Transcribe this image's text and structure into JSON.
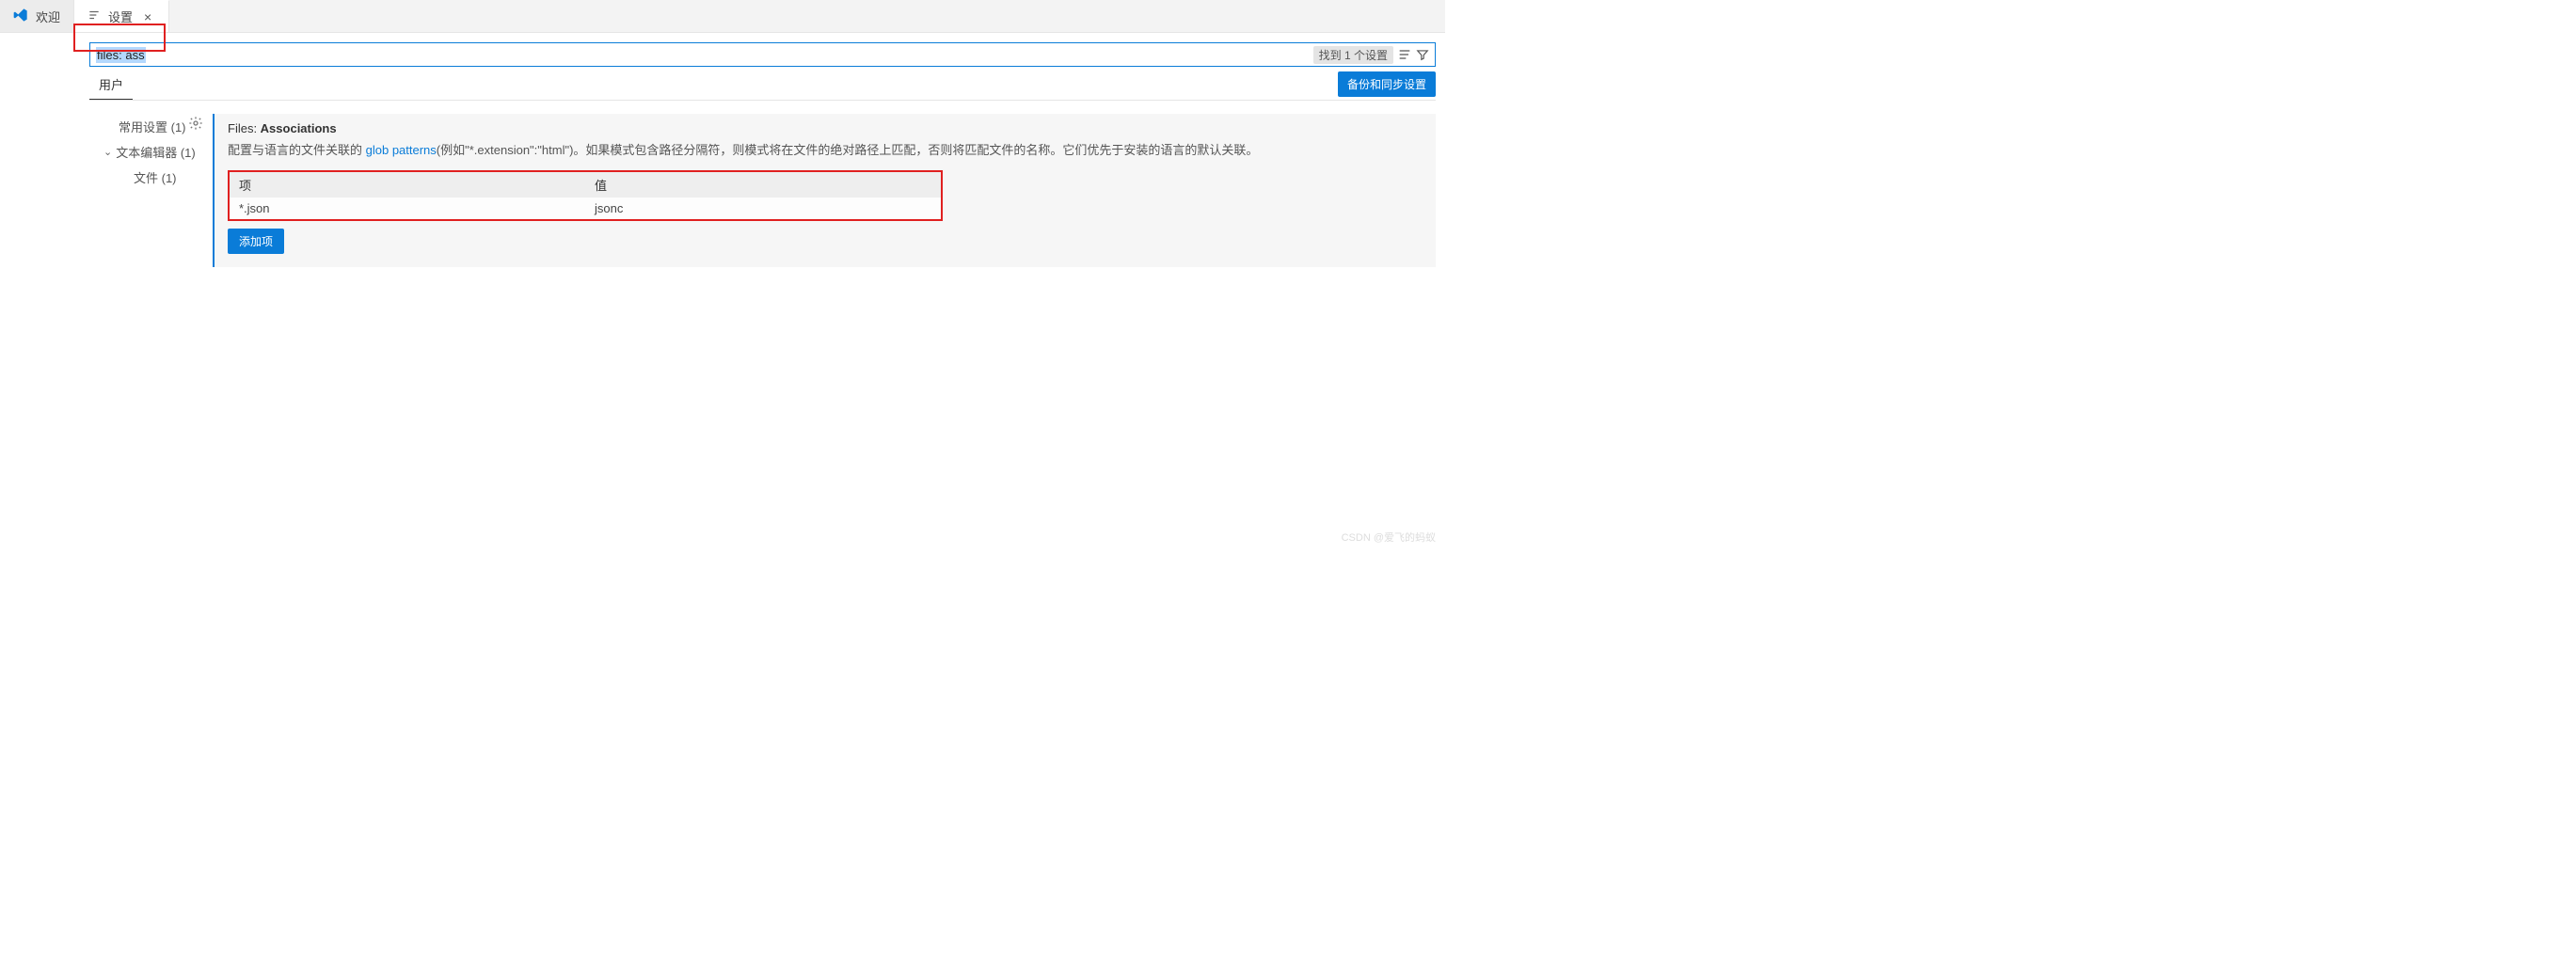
{
  "tabs": {
    "welcome": "欢迎",
    "settings": "设置"
  },
  "search": {
    "query": "files: ass",
    "count_label": "找到 1 个设置"
  },
  "subheader": {
    "user_tab": "用户",
    "backup_btn": "备份和同步设置"
  },
  "tree": {
    "common": "常用设置 (1)",
    "editor": "文本编辑器 (1)",
    "files": "文件 (1)"
  },
  "setting": {
    "group": "Files: ",
    "name": "Associations",
    "desc_pre": "配置与语言的文件关联的 ",
    "desc_link": "glob patterns",
    "desc_post": "(例如\"*.extension\":\"html\")。如果模式包含路径分隔符，则模式将在文件的绝对路径上匹配，否则将匹配文件的名称。它们优先于安装的语言的默认关联。",
    "col_key": "项",
    "col_val": "值",
    "row_key": "*.json",
    "row_val": "jsonc",
    "add_btn": "添加项"
  },
  "watermark": "CSDN @爱飞的蚂蚁"
}
